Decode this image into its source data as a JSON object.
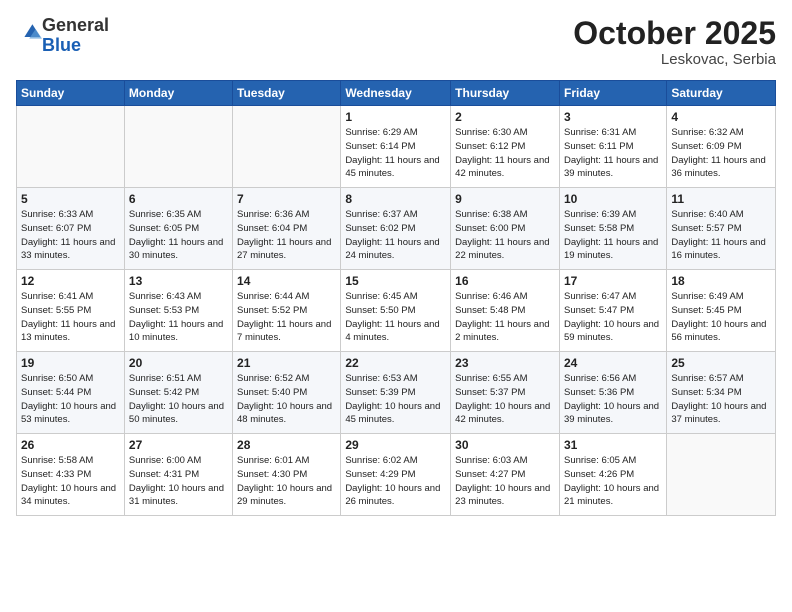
{
  "logo": {
    "general": "General",
    "blue": "Blue"
  },
  "header": {
    "month": "October 2025",
    "location": "Leskovac, Serbia"
  },
  "weekdays": [
    "Sunday",
    "Monday",
    "Tuesday",
    "Wednesday",
    "Thursday",
    "Friday",
    "Saturday"
  ],
  "weeks": [
    [
      {
        "day": "",
        "info": ""
      },
      {
        "day": "",
        "info": ""
      },
      {
        "day": "",
        "info": ""
      },
      {
        "day": "1",
        "info": "Sunrise: 6:29 AM\nSunset: 6:14 PM\nDaylight: 11 hours\nand 45 minutes."
      },
      {
        "day": "2",
        "info": "Sunrise: 6:30 AM\nSunset: 6:12 PM\nDaylight: 11 hours\nand 42 minutes."
      },
      {
        "day": "3",
        "info": "Sunrise: 6:31 AM\nSunset: 6:11 PM\nDaylight: 11 hours\nand 39 minutes."
      },
      {
        "day": "4",
        "info": "Sunrise: 6:32 AM\nSunset: 6:09 PM\nDaylight: 11 hours\nand 36 minutes."
      }
    ],
    [
      {
        "day": "5",
        "info": "Sunrise: 6:33 AM\nSunset: 6:07 PM\nDaylight: 11 hours\nand 33 minutes."
      },
      {
        "day": "6",
        "info": "Sunrise: 6:35 AM\nSunset: 6:05 PM\nDaylight: 11 hours\nand 30 minutes."
      },
      {
        "day": "7",
        "info": "Sunrise: 6:36 AM\nSunset: 6:04 PM\nDaylight: 11 hours\nand 27 minutes."
      },
      {
        "day": "8",
        "info": "Sunrise: 6:37 AM\nSunset: 6:02 PM\nDaylight: 11 hours\nand 24 minutes."
      },
      {
        "day": "9",
        "info": "Sunrise: 6:38 AM\nSunset: 6:00 PM\nDaylight: 11 hours\nand 22 minutes."
      },
      {
        "day": "10",
        "info": "Sunrise: 6:39 AM\nSunset: 5:58 PM\nDaylight: 11 hours\nand 19 minutes."
      },
      {
        "day": "11",
        "info": "Sunrise: 6:40 AM\nSunset: 5:57 PM\nDaylight: 11 hours\nand 16 minutes."
      }
    ],
    [
      {
        "day": "12",
        "info": "Sunrise: 6:41 AM\nSunset: 5:55 PM\nDaylight: 11 hours\nand 13 minutes."
      },
      {
        "day": "13",
        "info": "Sunrise: 6:43 AM\nSunset: 5:53 PM\nDaylight: 11 hours\nand 10 minutes."
      },
      {
        "day": "14",
        "info": "Sunrise: 6:44 AM\nSunset: 5:52 PM\nDaylight: 11 hours\nand 7 minutes."
      },
      {
        "day": "15",
        "info": "Sunrise: 6:45 AM\nSunset: 5:50 PM\nDaylight: 11 hours\nand 4 minutes."
      },
      {
        "day": "16",
        "info": "Sunrise: 6:46 AM\nSunset: 5:48 PM\nDaylight: 11 hours\nand 2 minutes."
      },
      {
        "day": "17",
        "info": "Sunrise: 6:47 AM\nSunset: 5:47 PM\nDaylight: 10 hours\nand 59 minutes."
      },
      {
        "day": "18",
        "info": "Sunrise: 6:49 AM\nSunset: 5:45 PM\nDaylight: 10 hours\nand 56 minutes."
      }
    ],
    [
      {
        "day": "19",
        "info": "Sunrise: 6:50 AM\nSunset: 5:44 PM\nDaylight: 10 hours\nand 53 minutes."
      },
      {
        "day": "20",
        "info": "Sunrise: 6:51 AM\nSunset: 5:42 PM\nDaylight: 10 hours\nand 50 minutes."
      },
      {
        "day": "21",
        "info": "Sunrise: 6:52 AM\nSunset: 5:40 PM\nDaylight: 10 hours\nand 48 minutes."
      },
      {
        "day": "22",
        "info": "Sunrise: 6:53 AM\nSunset: 5:39 PM\nDaylight: 10 hours\nand 45 minutes."
      },
      {
        "day": "23",
        "info": "Sunrise: 6:55 AM\nSunset: 5:37 PM\nDaylight: 10 hours\nand 42 minutes."
      },
      {
        "day": "24",
        "info": "Sunrise: 6:56 AM\nSunset: 5:36 PM\nDaylight: 10 hours\nand 39 minutes."
      },
      {
        "day": "25",
        "info": "Sunrise: 6:57 AM\nSunset: 5:34 PM\nDaylight: 10 hours\nand 37 minutes."
      }
    ],
    [
      {
        "day": "26",
        "info": "Sunrise: 5:58 AM\nSunset: 4:33 PM\nDaylight: 10 hours\nand 34 minutes."
      },
      {
        "day": "27",
        "info": "Sunrise: 6:00 AM\nSunset: 4:31 PM\nDaylight: 10 hours\nand 31 minutes."
      },
      {
        "day": "28",
        "info": "Sunrise: 6:01 AM\nSunset: 4:30 PM\nDaylight: 10 hours\nand 29 minutes."
      },
      {
        "day": "29",
        "info": "Sunrise: 6:02 AM\nSunset: 4:29 PM\nDaylight: 10 hours\nand 26 minutes."
      },
      {
        "day": "30",
        "info": "Sunrise: 6:03 AM\nSunset: 4:27 PM\nDaylight: 10 hours\nand 23 minutes."
      },
      {
        "day": "31",
        "info": "Sunrise: 6:05 AM\nSunset: 4:26 PM\nDaylight: 10 hours\nand 21 minutes."
      },
      {
        "day": "",
        "info": ""
      }
    ]
  ]
}
